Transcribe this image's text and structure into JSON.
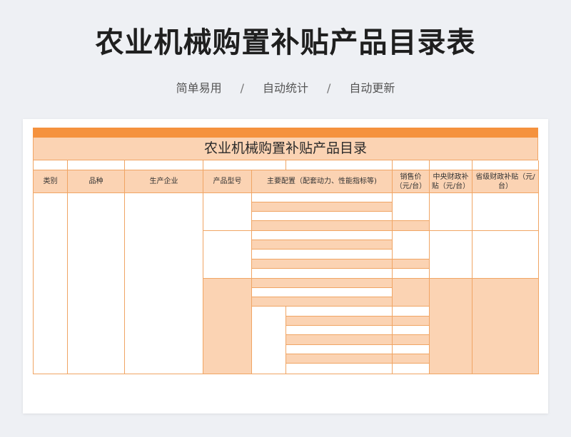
{
  "page": {
    "title": "农业机械购置补贴产品目录表",
    "tags": [
      "简单易用",
      "自动统计",
      "自动更新"
    ],
    "separator": "/"
  },
  "sheet": {
    "title": "农业机械购置补贴产品目录",
    "columns": [
      "类别",
      "品种",
      "生产企业",
      "产品型号",
      "主要配置（配套动力、性能指标等)",
      "销售价\n（元/台）",
      "中央财政补\n贴（元/台）",
      "省级财政补贴（元/\n台）"
    ]
  },
  "colors": {
    "accent_bar": "#f5923e",
    "peach_fill": "#fbd3b3",
    "grid_line": "#f0a564"
  }
}
